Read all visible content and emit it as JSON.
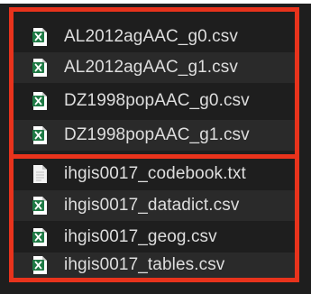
{
  "colors": {
    "background": "#1e1e1e",
    "row_alt": "#2a2a2a",
    "highlight": "#e8331c",
    "text": "#dedede",
    "excel_green": "#1f7a45",
    "doc_white": "#f2f2f2"
  },
  "files": [
    {
      "name": "AL2012agAAC_g0.csv",
      "icon": "excel-csv-icon"
    },
    {
      "name": "AL2012agAAC_g1.csv",
      "icon": "excel-csv-icon"
    },
    {
      "name": "DZ1998popAAC_g0.csv",
      "icon": "excel-csv-icon"
    },
    {
      "name": "DZ1998popAAC_g1.csv",
      "icon": "excel-csv-icon"
    },
    {
      "name": "ihgis0017_codebook.txt",
      "icon": "text-file-icon"
    },
    {
      "name": "ihgis0017_datadict.csv",
      "icon": "excel-csv-icon"
    },
    {
      "name": "ihgis0017_geog.csv",
      "icon": "excel-csv-icon"
    },
    {
      "name": "ihgis0017_tables.csv",
      "icon": "excel-csv-icon"
    }
  ]
}
